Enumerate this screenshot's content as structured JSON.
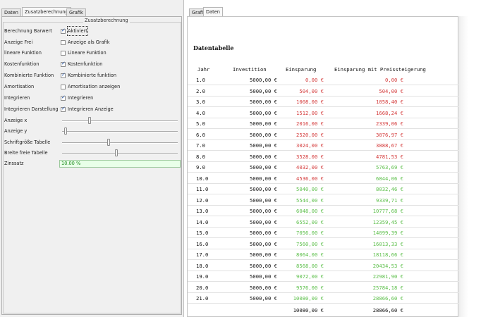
{
  "left_tabs": [
    "Daten",
    "Zusatzberechnung",
    "Grafik"
  ],
  "right_tabs": [
    "Grafik",
    "Daten"
  ],
  "group_title": "Zusatzberechnung",
  "settings": [
    {
      "label": "Berechnung Barwert",
      "checked": true,
      "option": "Aktiviert"
    },
    {
      "label": "Anzeige Frei",
      "checked": false,
      "option": "Anzeige als Grafik"
    },
    {
      "label": "lineare Funktion",
      "checked": false,
      "option": "Lineare Funktion"
    },
    {
      "label": "Kostenfunktion",
      "checked": true,
      "option": "Kostenfunktion"
    },
    {
      "label": "Kombinierte Funktion",
      "checked": true,
      "option": "Kombinierte funktion"
    },
    {
      "label": "Amortisation",
      "checked": false,
      "option": "Amortisation anzeigen"
    },
    {
      "label": "Integrieren",
      "checked": true,
      "option": "Integrieren"
    },
    {
      "label": "Integrieren Darstellung",
      "checked": true,
      "option": "Integrieren Anzeige"
    }
  ],
  "sliders": [
    {
      "label": "Anzeige x",
      "value": 0.24
    },
    {
      "label": "Anzeige y",
      "value": 0.03
    },
    {
      "label": "Schriftgröße Tabelle",
      "value": 0.4
    },
    {
      "label": "Breite freie Tabelle",
      "value": 0.47
    }
  ],
  "zinssatz": {
    "label": "Zinssatz",
    "value": "10.00 %"
  },
  "table": {
    "title": "Datentabelle",
    "headers": [
      "Jahr",
      "Investition",
      "Einsparung",
      "Einsparung mit Preissteigerung"
    ],
    "rows": [
      [
        "1.0",
        "5000,00 €",
        "0,00 €",
        "0,00 €"
      ],
      [
        "2.0",
        "5000,00 €",
        "504,00 €",
        "504,00 €"
      ],
      [
        "3.0",
        "5000,00 €",
        "1008,00 €",
        "1058,40 €"
      ],
      [
        "4.0",
        "5000,00 €",
        "1512,00 €",
        "1668,24 €"
      ],
      [
        "5.0",
        "5000,00 €",
        "2016,00 €",
        "2339,06 €"
      ],
      [
        "6.0",
        "5000,00 €",
        "2520,00 €",
        "3076,97 €"
      ],
      [
        "7.0",
        "5000,00 €",
        "3024,00 €",
        "3888,67 €"
      ],
      [
        "8.0",
        "5000,00 €",
        "3528,00 €",
        "4781,53 €"
      ],
      [
        "9.0",
        "5000,00 €",
        "4032,00 €",
        "5763,69 €"
      ],
      [
        "10.0",
        "5000,00 €",
        "4536,00 €",
        "6844,06 €"
      ],
      [
        "11.0",
        "5000,00 €",
        "5040,00 €",
        "8032,46 €"
      ],
      [
        "12.0",
        "5000,00 €",
        "5544,00 €",
        "9339,71 €"
      ],
      [
        "13.0",
        "5000,00 €",
        "6048,00 €",
        "10777,68 €"
      ],
      [
        "14.0",
        "5000,00 €",
        "6552,00 €",
        "12359,45 €"
      ],
      [
        "15.0",
        "5000,00 €",
        "7056,00 €",
        "14099,39 €"
      ],
      [
        "16.0",
        "5000,00 €",
        "7560,00 €",
        "16013,33 €"
      ],
      [
        "17.0",
        "5000,00 €",
        "8064,00 €",
        "18118,66 €"
      ],
      [
        "18.0",
        "5000,00 €",
        "8568,00 €",
        "20434,53 €"
      ],
      [
        "19.0",
        "5000,00 €",
        "9072,00 €",
        "22981,90 €"
      ],
      [
        "20.0",
        "5000,00 €",
        "9576,00 €",
        "25784,18 €"
      ],
      [
        "21.0",
        "5000,00 €",
        "10080,00 €",
        "28866,60 €"
      ]
    ],
    "ein_colors": [
      "red",
      "red",
      "red",
      "red",
      "red",
      "red",
      "red",
      "red",
      "red",
      "red",
      "green",
      "green",
      "green",
      "green",
      "green",
      "green",
      "green",
      "green",
      "green",
      "green",
      "green"
    ],
    "mit_colors": [
      "red",
      "red",
      "red",
      "red",
      "red",
      "red",
      "red",
      "red",
      "green",
      "green",
      "green",
      "green",
      "green",
      "green",
      "green",
      "green",
      "green",
      "green",
      "green",
      "green",
      "green"
    ],
    "totals": {
      "einsparung": "10080,00 €",
      "mit": "28866,60 €"
    }
  },
  "colors": {
    "negative": "#d43a3a",
    "positive": "#5cbf4a",
    "zins_bg": "#e8ffe8"
  }
}
